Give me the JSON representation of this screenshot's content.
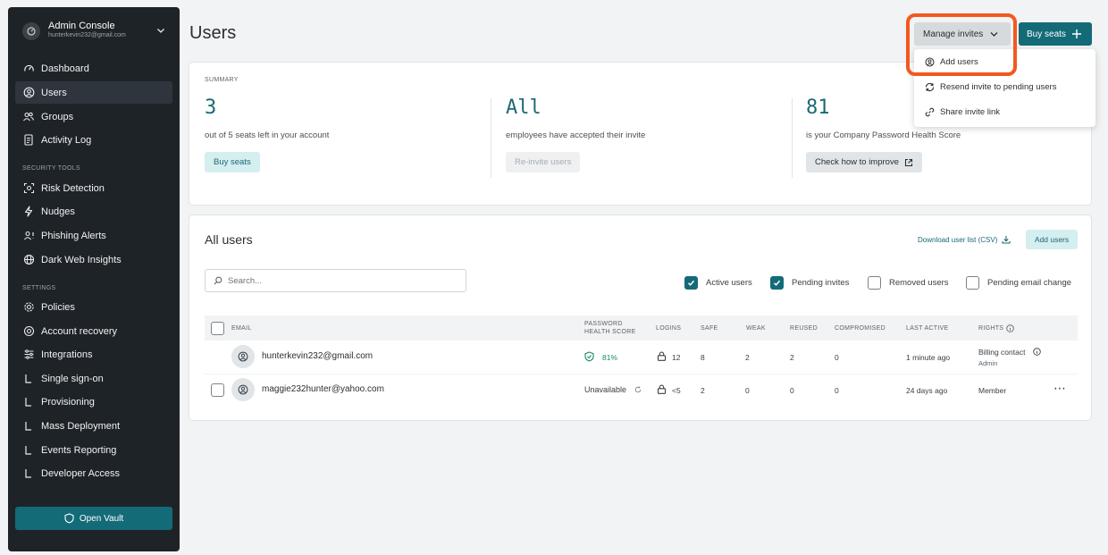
{
  "sidebar": {
    "account_title": "Admin Console",
    "account_email": "hunterkevin232@gmail.com",
    "nav": [
      {
        "label": "Dashboard",
        "icon": "gauge-icon"
      },
      {
        "label": "Users",
        "icon": "user-circle-icon",
        "active": true
      },
      {
        "label": "Groups",
        "icon": "users-icon"
      },
      {
        "label": "Activity Log",
        "icon": "document-icon"
      }
    ],
    "security_label": "SECURITY TOOLS",
    "security": [
      {
        "label": "Risk Detection",
        "icon": "scan-icon"
      },
      {
        "label": "Nudges",
        "icon": "lightning-icon"
      },
      {
        "label": "Phishing Alerts",
        "icon": "user-alert-icon"
      },
      {
        "label": "Dark Web Insights",
        "icon": "globe-icon"
      }
    ],
    "settings_label": "SETTINGS",
    "settings": [
      {
        "label": "Policies",
        "icon": "gear-icon"
      },
      {
        "label": "Account recovery",
        "icon": "recovery-icon"
      },
      {
        "label": "Integrations",
        "icon": "sliders-icon"
      },
      {
        "label": "Single sign-on",
        "icon": "sub-item-icon"
      },
      {
        "label": "Provisioning",
        "icon": "sub-item-icon"
      },
      {
        "label": "Mass Deployment",
        "icon": "sub-item-icon"
      },
      {
        "label": "Events Reporting",
        "icon": "sub-item-icon"
      },
      {
        "label": "Developer Access",
        "icon": "sub-item-icon"
      }
    ],
    "open_vault": "Open Vault"
  },
  "header": {
    "title": "Users",
    "manage_invites": "Manage invites",
    "buy_seats": "Buy seats"
  },
  "dropdown": {
    "items": [
      "Add users",
      "Resend invite to pending users",
      "Share invite link"
    ]
  },
  "summary": {
    "label": "SUMMARY",
    "metrics": [
      {
        "value": "3",
        "desc": "out of 5 seats left in your account",
        "button": "Buy seats"
      },
      {
        "value": "All",
        "desc": "employees have accepted their invite",
        "button": "Re-invite users"
      },
      {
        "value": "81",
        "desc": "is your Company Password Health Score",
        "button": "Check how to improve"
      }
    ]
  },
  "users": {
    "title": "All users",
    "download": "Download user list (CSV)",
    "add_users": "Add users",
    "search_placeholder": "Search...",
    "filters": [
      {
        "label": "Active users",
        "checked": true
      },
      {
        "label": "Pending invites",
        "checked": true
      },
      {
        "label": "Removed users",
        "checked": false
      },
      {
        "label": "Pending email change",
        "checked": false
      }
    ],
    "columns": {
      "email": "EMAIL",
      "health_1": "PASSWORD",
      "health_2": "HEALTH SCORE",
      "logins": "LOGINS",
      "safe": "SAFE",
      "weak": "WEAK",
      "reused": "REUSED",
      "compromised": "COMPROMISED",
      "last_active": "LAST ACTIVE",
      "rights": "RIGHTS"
    },
    "rows": [
      {
        "email": "hunterkevin232@gmail.com",
        "health": "81%",
        "logins": "12",
        "safe": "8",
        "weak": "2",
        "reused": "2",
        "compromised": "0",
        "last_active": "1 minute ago",
        "rights": "Billing contact",
        "rights_sub": "Admin"
      },
      {
        "email": "maggie232hunter@yahoo.com",
        "health": "Unavailable",
        "logins": "<5",
        "safe": "2",
        "weak": "0",
        "reused": "0",
        "compromised": "0",
        "last_active": "24 days ago",
        "rights": "Member",
        "more": "⋯"
      }
    ]
  },
  "colors": {
    "accent": "#146b78",
    "highlight": "#f2591f",
    "sidebar_bg": "#1e2328",
    "health_green": "#1a8a5a"
  }
}
